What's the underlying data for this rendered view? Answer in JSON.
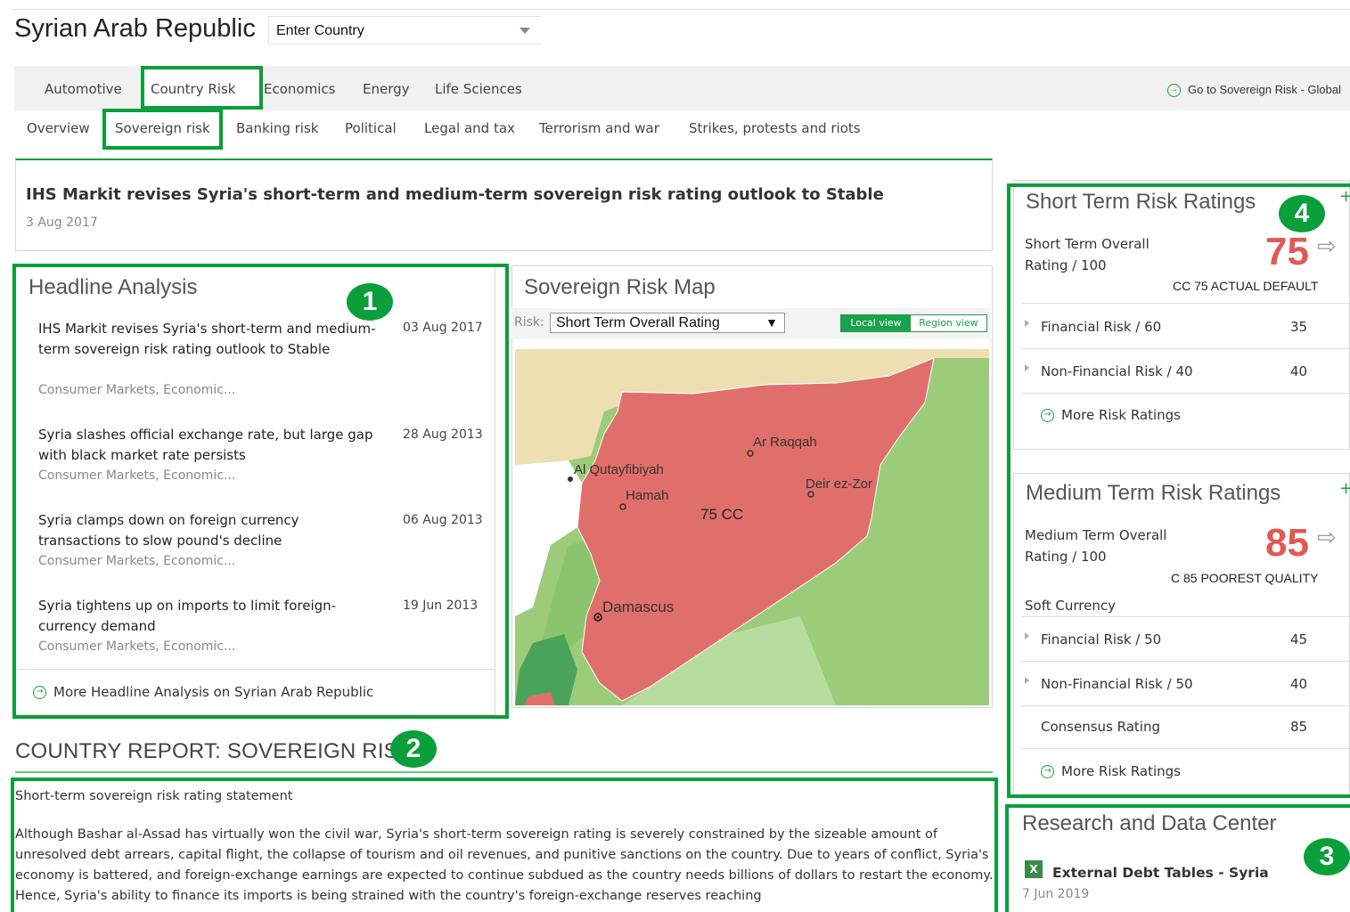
{
  "header": {
    "title": "Syrian Arab Republic",
    "country_input_value": "Enter Country"
  },
  "main_tabs": [
    {
      "label": "Automotive",
      "active": false
    },
    {
      "label": "Country Risk",
      "active": true
    },
    {
      "label": "Economics",
      "active": false
    },
    {
      "label": "Energy",
      "active": false
    },
    {
      "label": "Life Sciences",
      "active": false
    }
  ],
  "goto_link": "Go to Sovereign Risk - Global",
  "sub_tabs": [
    {
      "label": "Overview",
      "active": false
    },
    {
      "label": "Sovereign risk",
      "active": true
    },
    {
      "label": "Banking risk",
      "active": false
    },
    {
      "label": "Political",
      "active": false
    },
    {
      "label": "Legal and tax",
      "active": false
    },
    {
      "label": "Terrorism and war",
      "active": false
    },
    {
      "label": "Strikes, protests and riots",
      "active": false
    }
  ],
  "top_story": {
    "title": "IHS Markit revises Syria's short-term and medium-term sovereign risk rating outlook to Stable",
    "date": "3 Aug 2017"
  },
  "headline_analysis": {
    "title": "Headline Analysis",
    "items": [
      {
        "title": "IHS Markit revises Syria's short-term and medium-term sovereign risk rating outlook to Stable",
        "date": "03 Aug 2017",
        "tags": "Consumer Markets, Economic..."
      },
      {
        "title": "Syria slashes official exchange rate, but large gap with black market rate persists",
        "date": "28 Aug 2013",
        "tags": "Consumer Markets, Economic..."
      },
      {
        "title": "Syria clamps down on foreign currency transactions to slow pound's decline",
        "date": "06 Aug 2013",
        "tags": "Consumer Markets, Economic..."
      },
      {
        "title": "Syria tightens up on imports to limit foreign-currency demand",
        "date": "19 Jun 2013",
        "tags": "Consumer Markets, Economic..."
      }
    ],
    "more_link": "More Headline Analysis on Syrian Arab Republic"
  },
  "sovereign_map": {
    "title": "Sovereign Risk Map",
    "risk_label": "Risk:",
    "risk_select_value": "Short Term Overall Rating",
    "view_local": "Local view",
    "view_region": "Region view",
    "rating_label": "75 CC",
    "cities": [
      "Ar Raqqah",
      "Al Qutayfibiyah",
      "Hamah",
      "Deir ez-Zor",
      "Damascus"
    ],
    "colors": {
      "syria": "#e06f6c",
      "neighbor_light": "#9ccc7a",
      "neighbor_tan": "#eedfb3",
      "neighbor_dark": "#4aa35a"
    }
  },
  "short_term": {
    "title": "Short Term Risk Ratings",
    "overall_label": "Short Term Overall Rating / 100",
    "overall_value": "75",
    "note": "CC 75 ACTUAL DEFAULT",
    "rows": [
      {
        "label": "Financial Risk / 60",
        "value": "35"
      },
      {
        "label": "Non-Financial Risk / 40",
        "value": "40"
      }
    ],
    "more_link": "More Risk Ratings"
  },
  "medium_term": {
    "title": "Medium Term Risk Ratings",
    "overall_label": "Medium Term Overall Rating / 100",
    "overall_value": "85",
    "note": "C 85 POOREST QUALITY",
    "currency": "Soft Currency",
    "rows": [
      {
        "label": "Financial Risk / 50",
        "value": "45"
      },
      {
        "label": "Non-Financial Risk / 50",
        "value": "40"
      },
      {
        "label": "Consensus Rating",
        "value": "85"
      }
    ],
    "more_link": "More Risk Ratings"
  },
  "research": {
    "title": "Research and Data Center",
    "item_icon": "X",
    "item_title": "External Debt Tables - Syria",
    "item_date": "7 Jun 2019"
  },
  "report": {
    "heading": "COUNTRY REPORT: SOVEREIGN RISK",
    "subheading": "Short-term sovereign risk rating statement",
    "body": "Although Bashar al-Assad has virtually won the civil war, Syria's short-term sovereign rating is severely constrained by the sizeable amount of unresolved debt arrears, capital flight, the collapse of tourism and oil revenues, and punitive sanctions on the country. Due to years of conflict, Syria's economy is battered, and foreign-exchange earnings are expected to continue subdued as the country needs billions of dollars to restart the economy. Hence, Syria's ability to finance its imports is being strained with the country's foreign-exchange reserves reaching"
  },
  "annotations": {
    "badge_1": "1",
    "badge_2": "2",
    "badge_3": "3",
    "badge_4": "4"
  },
  "accent_color": "#0a9f3a",
  "rating_color": "#e05a55"
}
